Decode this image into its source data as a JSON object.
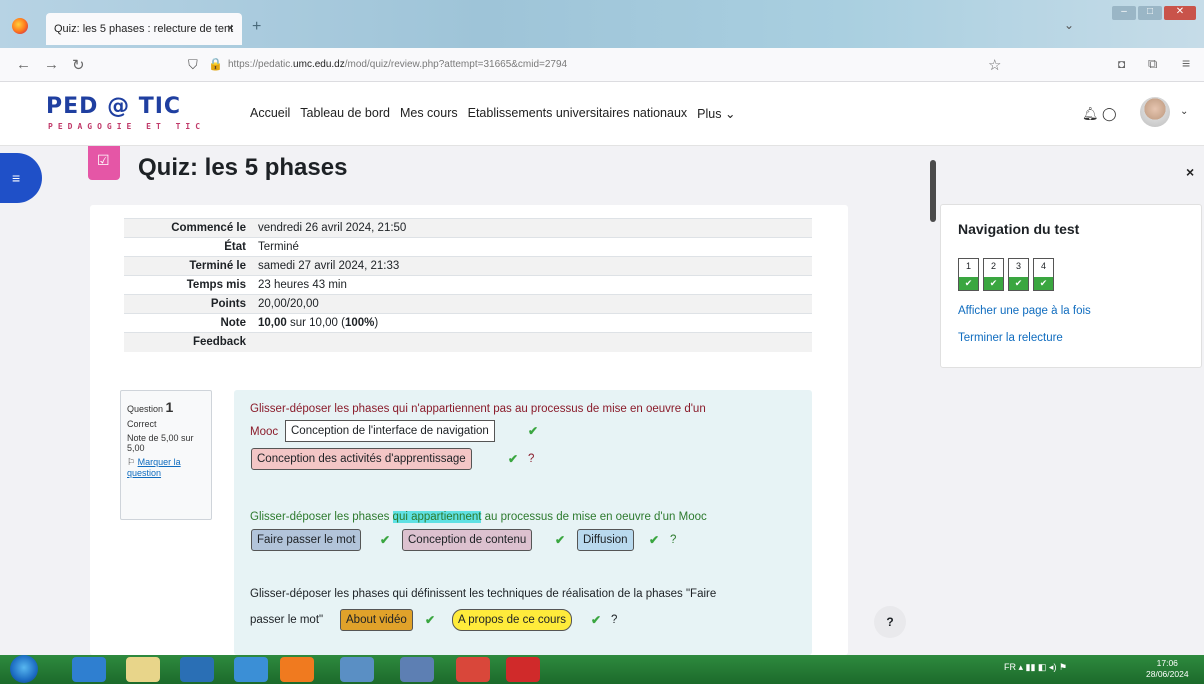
{
  "browser": {
    "tab_title": "Quiz: les 5 phases : relecture de tent",
    "tab_close": "×",
    "new_tab": "+",
    "url_prefix": "https://pedatic.",
    "url_domain": "umc.edu.dz",
    "url_path": "/mod/quiz/review.php?attempt=31665&cmid=2794"
  },
  "site": {
    "logo_main": "PED @ TIC",
    "logo_sub": "PEDAGOGIE ET TIC",
    "nav": [
      "Accueil",
      "Tableau de bord",
      "Mes cours",
      "Etablissements universitaires nationaux",
      "Plus ⌄"
    ]
  },
  "page": {
    "title": "Quiz: les 5 phases"
  },
  "summary": [
    {
      "label": "Commencé le",
      "value": "vendredi 26 avril 2024, 21:50"
    },
    {
      "label": "État",
      "value": "Terminé"
    },
    {
      "label": "Terminé le",
      "value": "samedi 27 avril 2024, 21:33"
    },
    {
      "label": "Temps mis",
      "value": "23 heures 43 min"
    },
    {
      "label": "Points",
      "value": "20,00/20,00"
    },
    {
      "label": "Note",
      "value_bold": "10,00",
      "value_mid": " sur 10,00 (",
      "value_pct": "100%",
      "value_end": ")"
    },
    {
      "label": "Feedback",
      "value": ""
    }
  ],
  "question_info": {
    "label": "Question",
    "number": "1",
    "state": "Correct",
    "grade": "Note de 5,00 sur 5,00",
    "flag": "Marquer la question"
  },
  "question": {
    "p1_line1": "Glisser-déposer les phases qui n'appartiennent pas au processus de mise en oeuvre d'un",
    "p1_line2": "Mooc",
    "drop1": "Conception de l'interface de navigation",
    "drop2": "Conception des activités d'apprentissage",
    "p2_before": "Glisser-déposer les phases ",
    "p2_hl": "qui appartiennent",
    "p2_after": " au processus de mise en oeuvre d'un Mooc",
    "drop3": "Faire passer le mot",
    "drop4": "Conception de contenu",
    "drop5": "Diffusion",
    "p3_line1": "Glisser-déposer les phases qui définissent les techniques de réalisation de la phases \"Faire",
    "p3_line2": "passer le mot\"",
    "drop6": "About vidéo",
    "drop7": "A propos de ce cours",
    "qmark": "?"
  },
  "quiz_nav": {
    "title": "Navigation du test",
    "questions": [
      "1",
      "2",
      "3",
      "4"
    ],
    "link_one_page": "Afficher une page à la fois",
    "link_finish": "Terminer la relecture"
  },
  "help": "?",
  "drawer_close": "×",
  "taskbar": {
    "lang": "FR",
    "time": "17:06",
    "date": "28/06/2024"
  },
  "colors": {
    "brand_blue": "#1f50c8",
    "quiz_pink": "#e556a6",
    "correct_green": "#3aa640",
    "link_blue": "#0f6cbf",
    "question_bg": "#e7f3f5"
  }
}
